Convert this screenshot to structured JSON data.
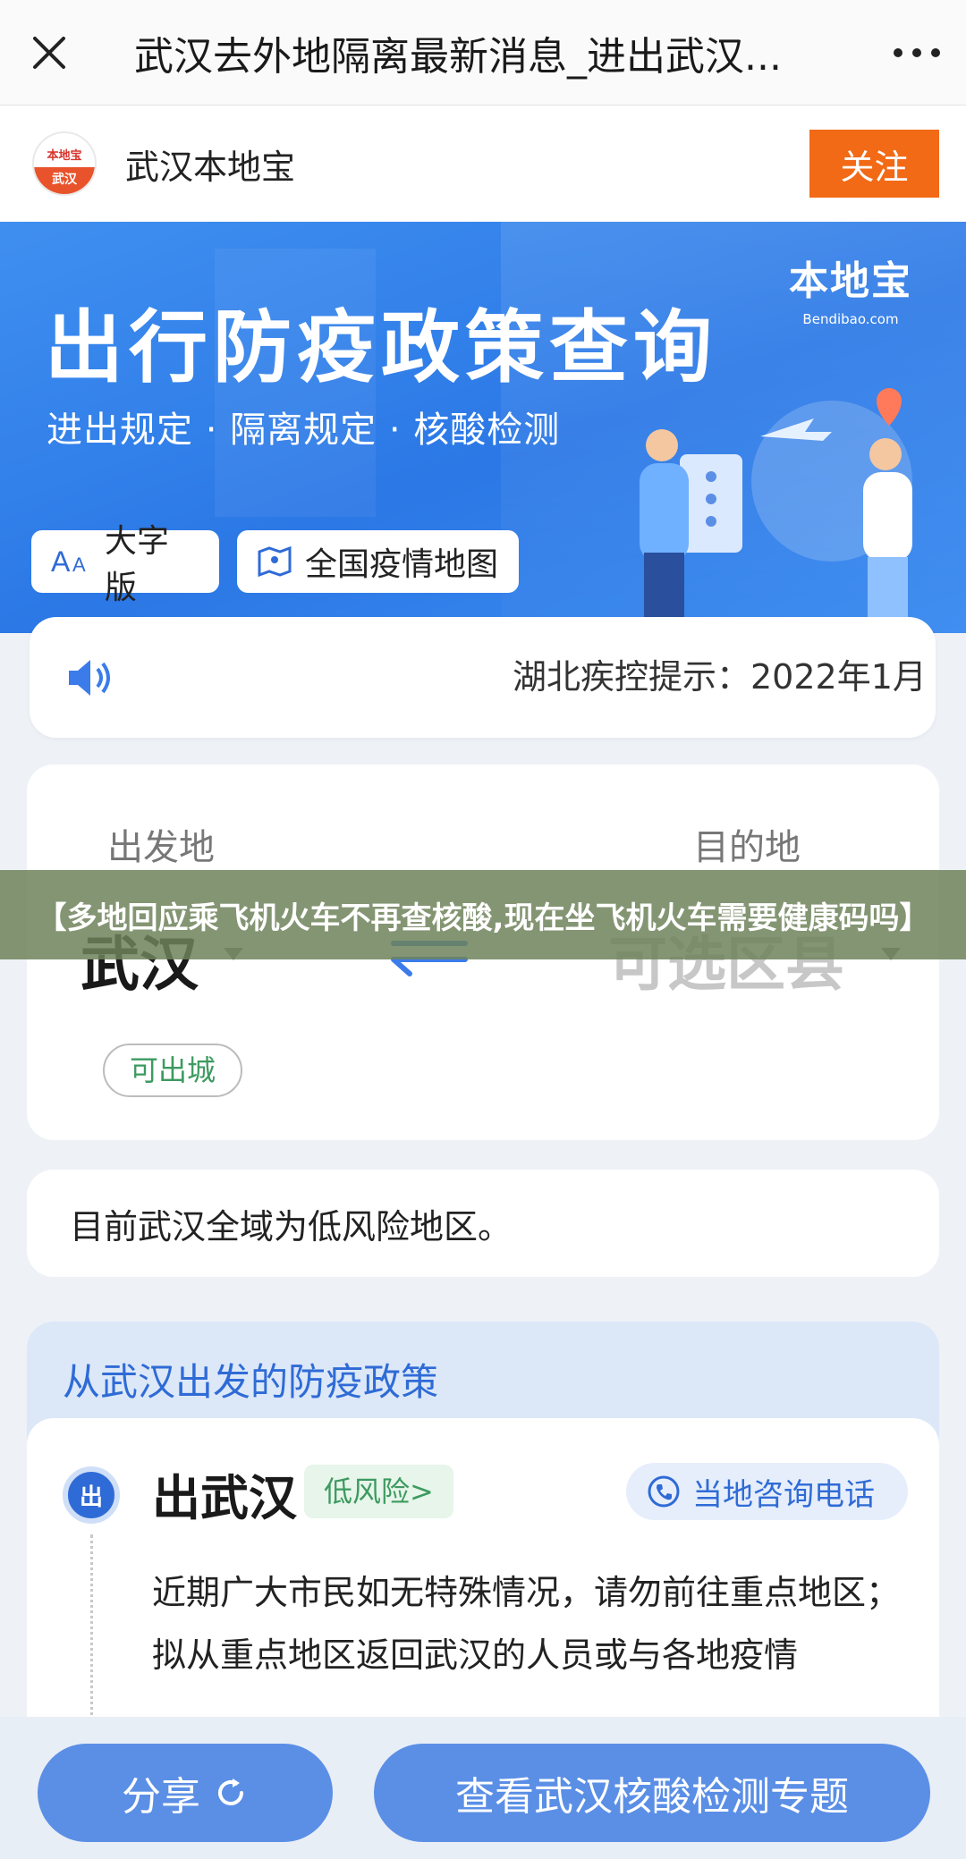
{
  "topbar": {
    "title": "武汉去外地隔离最新消息_进出武汉...",
    "close_icon": "close-icon",
    "more_icon": "more-icon"
  },
  "account": {
    "logo_line1": "本地宝",
    "logo_line2": "武汉",
    "name": "武汉本地宝",
    "follow_label": "关注"
  },
  "banner": {
    "headline": "出行防疫政策查询",
    "subtitle": "进出规定 · 隔离规定 · 核酸检测",
    "brand": "本地宝",
    "brand_url": "Bendibao.com",
    "large_font_label": "大字版",
    "map_label": "全国疫情地图"
  },
  "notice": {
    "text": "湖北疾控提示：2022年1月"
  },
  "route": {
    "from_label": "出发地",
    "to_label": "目的地",
    "from_city": "武汉",
    "to_city": "可选区县",
    "status": "可出城"
  },
  "risk": {
    "text": "目前武汉全域为低风险地区。"
  },
  "policy": {
    "header": "从武汉出发的防疫政策",
    "dot_label": "出",
    "out_title": "出武汉",
    "level": "低风险>",
    "phone_label": "当地咨询电话",
    "paragraph": "近期广大市民如无特殊情况，请勿前往重点地区；拟从重点地区返回武汉的人员或与各地疫情"
  },
  "caption": "【多地回应乘飞机火车不再查核酸,现在坐飞机火车需要健康码吗】",
  "bottom": {
    "share_label": "分享",
    "topic_label": "查看武汉核酸检测专题"
  },
  "colors": {
    "accent_blue": "#2f6bd6",
    "banner_blue": "#2b78e6",
    "follow_orange": "#f26a16",
    "green_status": "#3d9a60"
  }
}
